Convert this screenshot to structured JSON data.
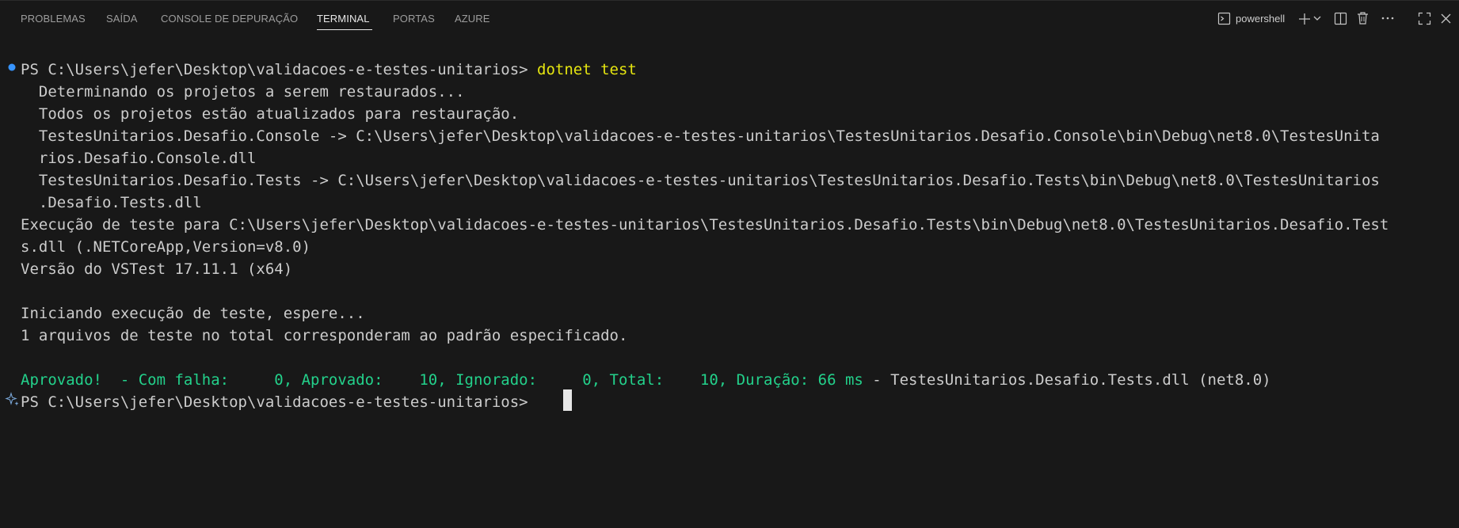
{
  "tabs": [
    {
      "label": "PROBLEMAS"
    },
    {
      "label": "SAÍDA"
    },
    {
      "label": "CONSOLE DE DEPURAÇÃO"
    },
    {
      "label": "TERMINAL"
    },
    {
      "label": "PORTAS"
    },
    {
      "label": "AZURE"
    }
  ],
  "active_tab": "TERMINAL",
  "toolbar": {
    "shell_name": "powershell",
    "icons": [
      "terminal-icon",
      "add-icon",
      "chevron-down-icon",
      "split-icon",
      "trash-icon",
      "more-icon",
      "maximize-icon",
      "close-icon"
    ]
  },
  "terminal": {
    "prompt_path": "PS C:\\Users\\jefer\\Desktop\\validacoes-e-testes-unitarios> ",
    "command": "dotnet test",
    "output": [
      "  Determinando os projetos a serem restaurados...",
      "  Todos os projetos estão atualizados para restauração.",
      "  TestesUnitarios.Desafio.Console -> C:\\Users\\jefer\\Desktop\\validacoes-e-testes-unitarios\\TestesUnitarios.Desafio.Console\\bin\\Debug\\net8.0\\TestesUnita",
      "  rios.Desafio.Console.dll",
      "  TestesUnitarios.Desafio.Tests -> C:\\Users\\jefer\\Desktop\\validacoes-e-testes-unitarios\\TestesUnitarios.Desafio.Tests\\bin\\Debug\\net8.0\\TestesUnitarios",
      "  .Desafio.Tests.dll",
      "Execução de teste para C:\\Users\\jefer\\Desktop\\validacoes-e-testes-unitarios\\TestesUnitarios.Desafio.Tests\\bin\\Debug\\net8.0\\TestesUnitarios.Desafio.Test",
      "s.dll (.NETCoreApp,Version=v8.0)",
      "Versão do VSTest 17.11.1 (x64)",
      "",
      "Iniciando execução de teste, espere...",
      "1 arquivos de teste no total corresponderam ao padrão especificado."
    ],
    "result_green": "Aprovado!  - Com falha:     0, Aprovado:    10, Ignorado:     0, Total:    10, Duração: 66 ms",
    "result_rest": " - TestesUnitarios.Desafio.Tests.dll (net8.0)",
    "final_prompt": "PS C:\\Users\\jefer\\Desktop\\validacoes-e-testes-unitarios> ",
    "colors": {
      "background": "#181818",
      "text": "#cccccc",
      "command": "#e5e510",
      "success": "#23d18b",
      "decoration_dot": "#3794ff"
    }
  }
}
